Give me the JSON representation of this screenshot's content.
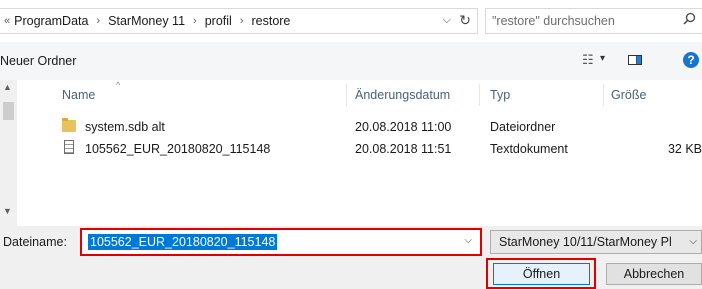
{
  "address_bar": {
    "overflow_glyph": "«",
    "crumbs": [
      "ProgramData",
      "StarMoney 11",
      "profil",
      "restore"
    ],
    "separator": "›",
    "dropdown_glyph": "⌵",
    "refresh_glyph": "↻"
  },
  "search": {
    "placeholder": "\"restore\" durchsuchen",
    "icon": "search-icon"
  },
  "toolbar": {
    "new_folder_label": "Neuer Ordner",
    "view_icon_glyph": "☷",
    "view_chevron_glyph": "▾",
    "help_glyph": "?",
    "help_color": "#1874cd"
  },
  "columns": {
    "name": "Name",
    "modified": "Änderungsdatum",
    "type": "Typ",
    "size": "Größe",
    "sort_glyph": "^"
  },
  "files": [
    {
      "icon": "folder-icon",
      "name": "system.sdb alt",
      "modified": "20.08.2018 11:00",
      "type": "Dateiordner",
      "size": ""
    },
    {
      "icon": "document-icon",
      "name": "105562_EUR_20180820_115148",
      "modified": "20.08.2018 11:51",
      "type": "Textdokument",
      "size": "32 KB"
    }
  ],
  "footer": {
    "filename_label": "Dateiname:",
    "filename_value": "105562_EUR_20180820_115148",
    "filetype_value": "StarMoney 10/11/StarMoney Pl",
    "dropdown_glyph": "⌵",
    "open_label": "Öffnen",
    "cancel_label": "Abbrechen",
    "highlight_color": "#e00000",
    "selection_color": "#0078d7"
  },
  "scrollbar": {
    "up_glyph": "▲",
    "down_glyph": "▼"
  }
}
